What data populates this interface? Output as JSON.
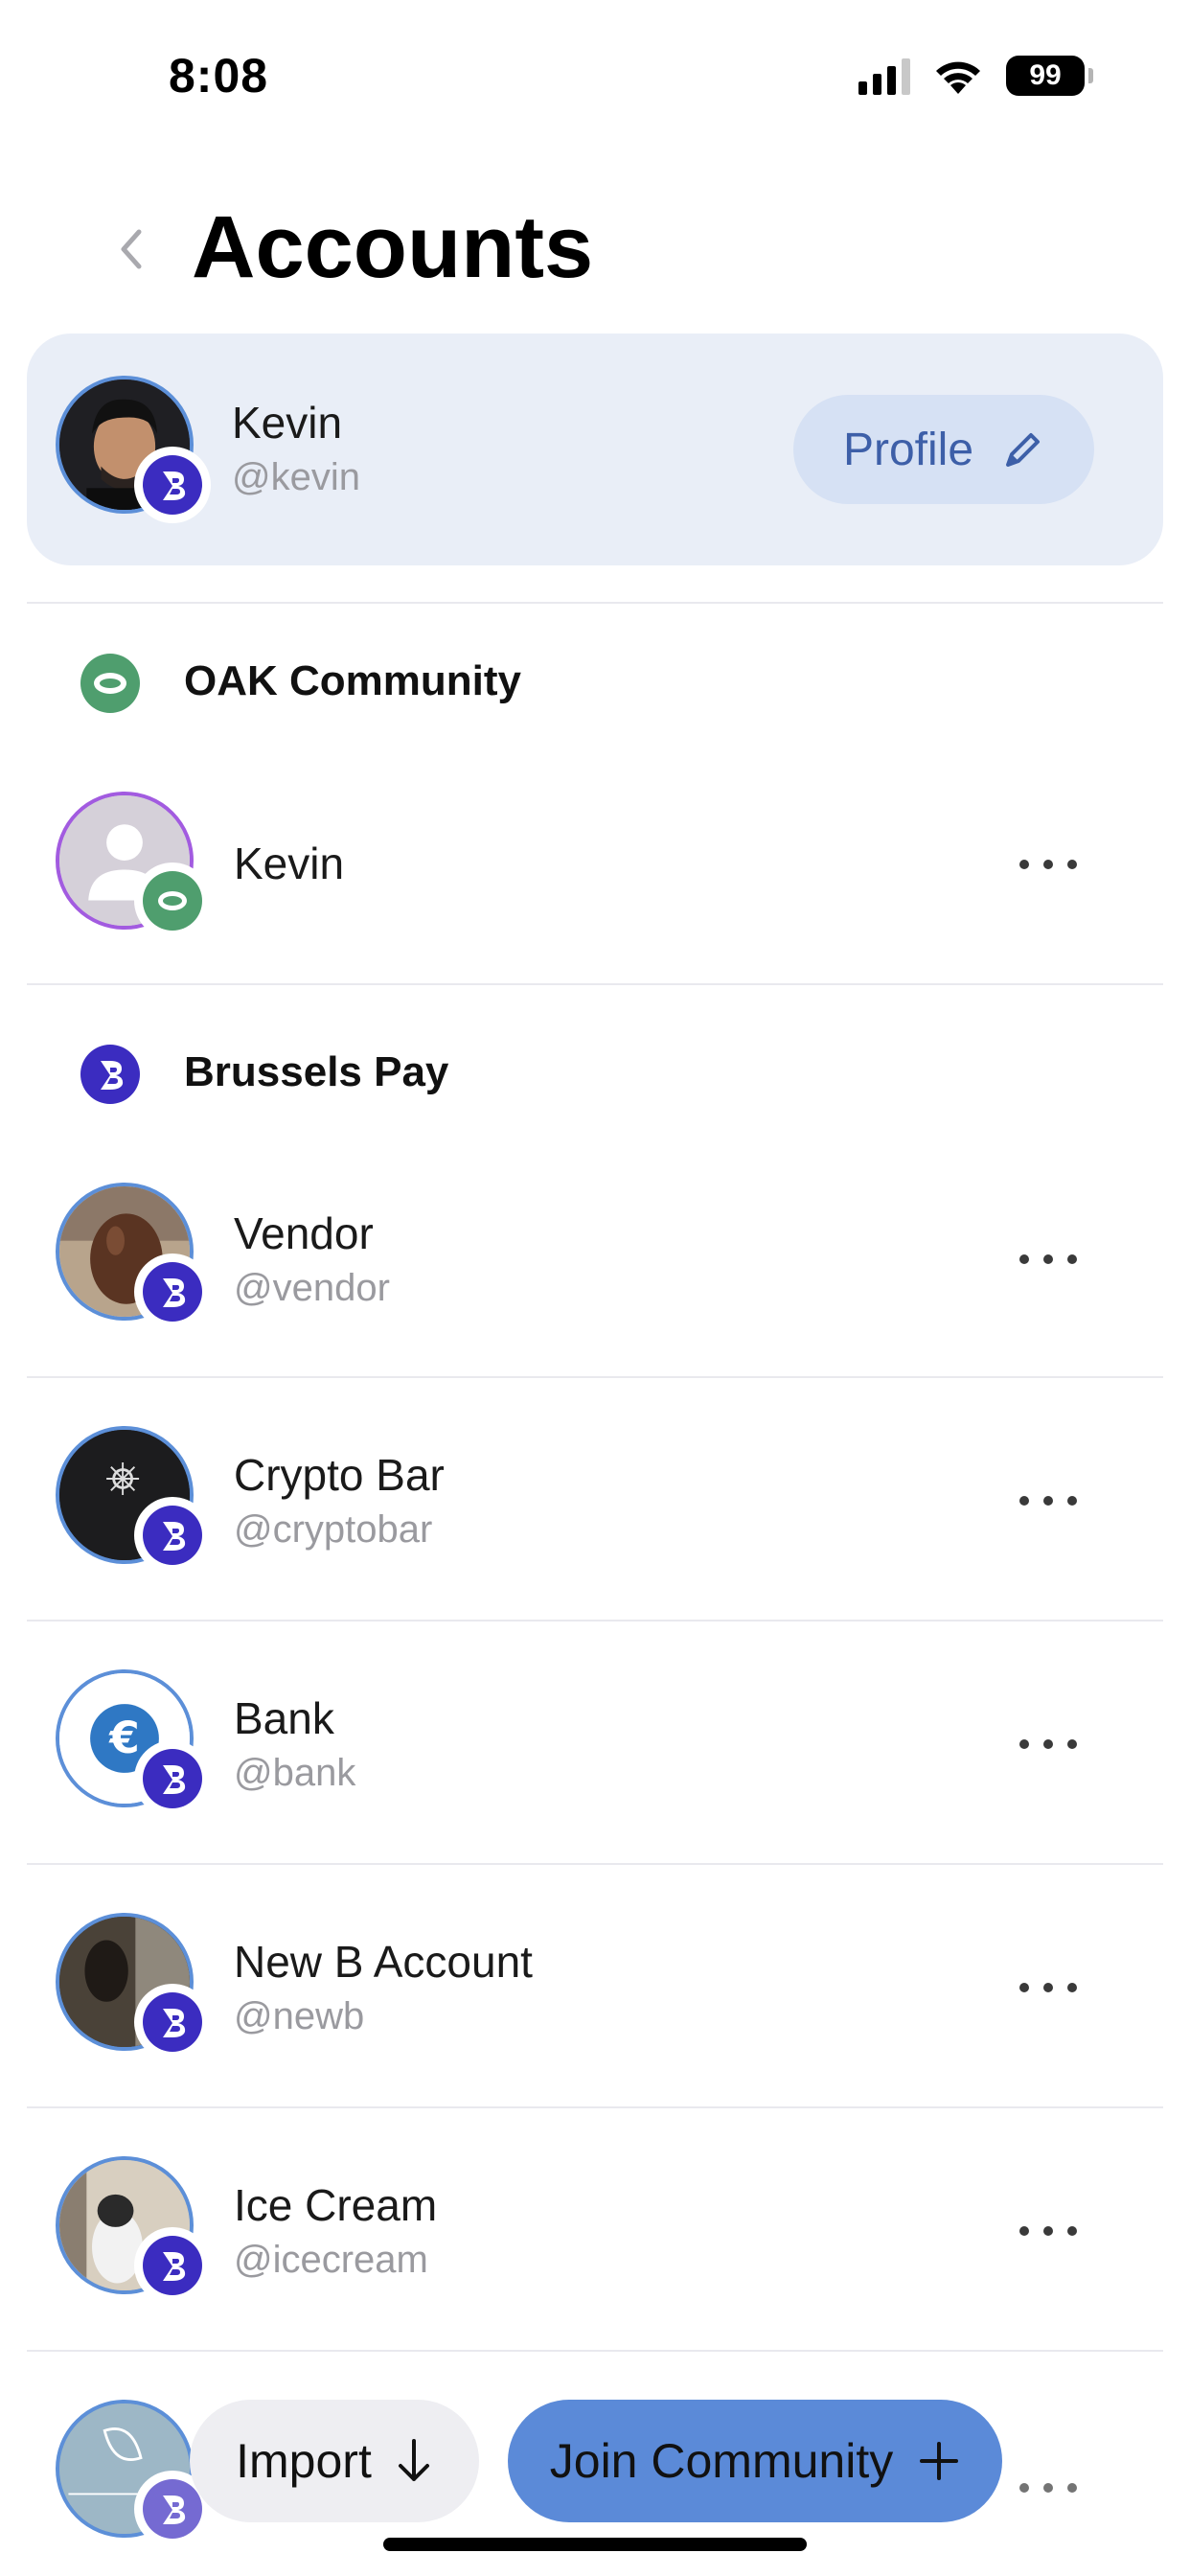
{
  "status_bar": {
    "time": "8:08",
    "battery": "99"
  },
  "header": {
    "title": "Accounts"
  },
  "main_account": {
    "name": "Kevin",
    "handle": "@kevin",
    "profile_label": "Profile"
  },
  "communities": [
    {
      "name": "OAK Community",
      "accounts": [
        {
          "name": "Kevin",
          "handle": ""
        }
      ]
    },
    {
      "name": "Brussels Pay",
      "accounts": [
        {
          "name": "Vendor",
          "handle": "@vendor"
        },
        {
          "name": "Crypto Bar",
          "handle": "@cryptobar"
        },
        {
          "name": "Bank",
          "handle": "@bank"
        },
        {
          "name": "New B Account",
          "handle": "@newb"
        },
        {
          "name": "Ice Cream",
          "handle": "@icecream"
        }
      ]
    }
  ],
  "actions": {
    "import_label": "Import",
    "join_label": "Join Community"
  },
  "colors": {
    "accent": "#5b8ad8",
    "brussels_pay": "#3b2cc0",
    "oak": "#4f9e6e",
    "card_bg": "#e9eef7"
  }
}
